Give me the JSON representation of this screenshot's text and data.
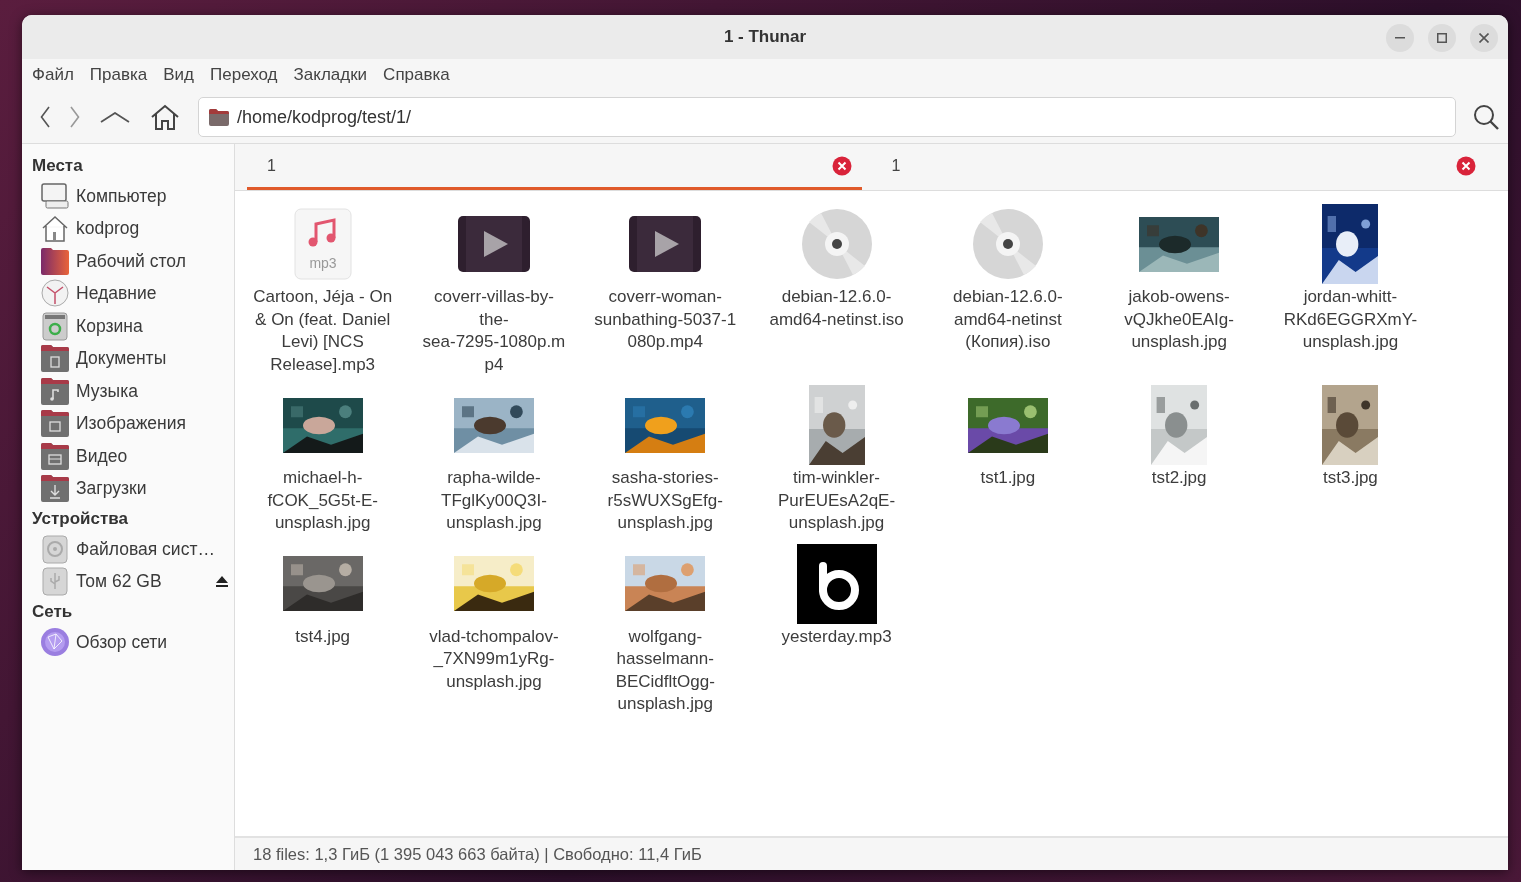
{
  "window": {
    "title": "1 - Thunar"
  },
  "menu": [
    "Файл",
    "Правка",
    "Вид",
    "Переход",
    "Закладки",
    "Справка"
  ],
  "location": {
    "path": "/home/kodprog/test/1/"
  },
  "sidebar": [
    {
      "heading": "Места",
      "items": [
        {
          "label": "Компьютер",
          "kind": "computer"
        },
        {
          "label": "kodprog",
          "kind": "home"
        },
        {
          "label": "Рабочий стол",
          "kind": "desktop"
        },
        {
          "label": "Недавние",
          "kind": "recent"
        },
        {
          "label": "Корзина",
          "kind": "trash"
        },
        {
          "label": "Документы",
          "kind": "documents"
        },
        {
          "label": "Музыка",
          "kind": "music"
        },
        {
          "label": "Изображения",
          "kind": "pictures"
        },
        {
          "label": "Видео",
          "kind": "videos"
        },
        {
          "label": "Загрузки",
          "kind": "downloads"
        }
      ]
    },
    {
      "heading": "Устройства",
      "items": [
        {
          "label": "Файловая сист…",
          "kind": "drive"
        },
        {
          "label": "Том 62 GB",
          "kind": "usb",
          "eject": true
        }
      ]
    },
    {
      "heading": "Сеть",
      "items": [
        {
          "label": "Обзор сети",
          "kind": "network"
        }
      ]
    }
  ],
  "tabs": [
    {
      "label": "1",
      "selected": true
    },
    {
      "label": "1",
      "selected": false
    }
  ],
  "files": [
    {
      "name_lines": [
        "Cartoon, Jéja - On",
        "& On (feat. Daniel",
        "Levi) [NCS",
        "Release].mp3"
      ],
      "kind": "audio",
      "badge": "mp3"
    },
    {
      "name_lines": [
        "coverr-villas-by-",
        "the-",
        "sea-7295-1080p.m",
        "p4"
      ],
      "kind": "video"
    },
    {
      "name_lines": [
        "coverr-woman-",
        "sunbathing-5037-1",
        "080p.mp4"
      ],
      "kind": "video"
    },
    {
      "name_lines": [
        "debian-12.6.0-",
        "amd64-netinst.iso"
      ],
      "kind": "disc"
    },
    {
      "name_lines": [
        "debian-12.6.0-",
        "amd64-netinst",
        "(Копия).iso"
      ],
      "kind": "disc"
    },
    {
      "name_lines": [
        "jakob-owens-",
        "vQJkhe0EAIg-",
        "unsplash.jpg"
      ],
      "kind": "picture"
    },
    {
      "name_lines": [
        "jordan-whitt-",
        "RKd6EGGRXmY-",
        "unsplash.jpg"
      ],
      "kind": "picture"
    },
    {
      "name_lines": [
        "michael-h-",
        "fCOK_5G5t-E-",
        "unsplash.jpg"
      ],
      "kind": "picture"
    },
    {
      "name_lines": [
        "rapha-wilde-",
        "TFglKy00Q3I-",
        "unsplash.jpg"
      ],
      "kind": "picture"
    },
    {
      "name_lines": [
        "sasha-stories-",
        "r5sWUXSgEfg-",
        "unsplash.jpg"
      ],
      "kind": "picture"
    },
    {
      "name_lines": [
        "tim-winkler-",
        "PurEUEsA2qE-",
        "unsplash.jpg"
      ],
      "kind": "picture"
    },
    {
      "name_lines": [
        "tst1.jpg"
      ],
      "kind": "picture"
    },
    {
      "name_lines": [
        "tst2.jpg"
      ],
      "kind": "picture"
    },
    {
      "name_lines": [
        "tst3.jpg"
      ],
      "kind": "picture"
    },
    {
      "name_lines": [
        "tst4.jpg"
      ],
      "kind": "picture"
    },
    {
      "name_lines": [
        "vlad-tchompalov-",
        "_7XN99m1yRg-",
        "unsplash.jpg"
      ],
      "kind": "picture"
    },
    {
      "name_lines": [
        "wolfgang-",
        "hasselmann-",
        "BECidfltOgg-",
        "unsplash.jpg"
      ],
      "kind": "picture"
    },
    {
      "name_lines": [
        "yesterday.mp3"
      ],
      "kind": "cover"
    }
  ],
  "status_bar": "18 files: 1,3 ГиБ (1 395 043 663 байта) | Свободно: 11,4 ГиБ"
}
